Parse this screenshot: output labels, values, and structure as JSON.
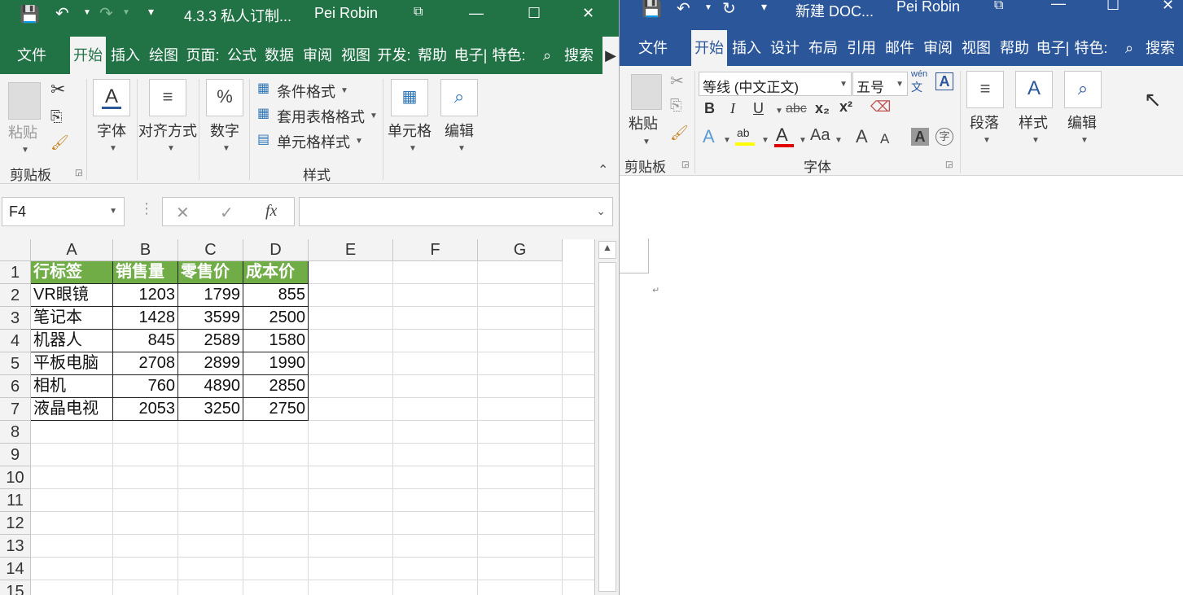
{
  "excel": {
    "title": "4.3.3 私人订制...",
    "user": "Pei Robin",
    "tabs": [
      "文件",
      "开始",
      "插入",
      "绘图",
      "页面:",
      "公式",
      "数据",
      "审阅",
      "视图",
      "开发:",
      "帮助",
      "电子|",
      "特色:"
    ],
    "search": "搜索",
    "ribbon": {
      "paste": "粘贴",
      "font": "字体",
      "align": "对齐方式",
      "number": "数字",
      "percent": "%",
      "cond": "条件格式",
      "table": "套用表格格式",
      "cellstyle": "单元格样式",
      "styles": "样式",
      "cells": "单元格",
      "edit": "编辑",
      "clipboard": "剪贴板"
    },
    "namebox": "F4",
    "fx": "fx",
    "columns": [
      "A",
      "B",
      "C",
      "D",
      "E",
      "F",
      "G"
    ],
    "rows": [
      "1",
      "2",
      "3",
      "4",
      "5",
      "6",
      "7",
      "8",
      "9",
      "10",
      "11",
      "12",
      "13",
      "14",
      "15"
    ],
    "table": {
      "headers": [
        "行标签",
        "销售量",
        "零售价",
        "成本价"
      ],
      "rows": [
        [
          "VR眼镜",
          "1203",
          "1799",
          "855"
        ],
        [
          "笔记本",
          "1428",
          "3599",
          "2500"
        ],
        [
          "机器人",
          "845",
          "2589",
          "1580"
        ],
        [
          "平板电脑",
          "2708",
          "2899",
          "1990"
        ],
        [
          "相机",
          "760",
          "4890",
          "2850"
        ],
        [
          "液晶电视",
          "2053",
          "3250",
          "2750"
        ]
      ]
    },
    "colors": {
      "theme": "#217346",
      "header_fill": "#70ad47"
    }
  },
  "word": {
    "title": "新建 DOC...",
    "user": "Pei Robin",
    "tabs": [
      "文件",
      "开始",
      "插入",
      "设计",
      "布局",
      "引用",
      "邮件",
      "审阅",
      "视图",
      "帮助",
      "电子|",
      "特色:"
    ],
    "search": "搜索",
    "ribbon": {
      "paste": "粘贴",
      "clipboard": "剪贴板",
      "fontname": "等线 (中文正文)",
      "fontsize": "五号",
      "font": "字体",
      "para": "段落",
      "style": "样式",
      "edit": "编辑",
      "wen": "wén",
      "wenzi": "文",
      "bold": "B",
      "italic": "I",
      "underline": "U",
      "strike": "abc",
      "sub": "x₂",
      "sup": "x²",
      "fontcolor": "A",
      "aa": "Aa",
      "grow": "A",
      "shrink": "A",
      "charshade": "A",
      "circle": "字"
    },
    "paragraph_mark": "↵",
    "colors": {
      "theme": "#2b579a"
    }
  }
}
